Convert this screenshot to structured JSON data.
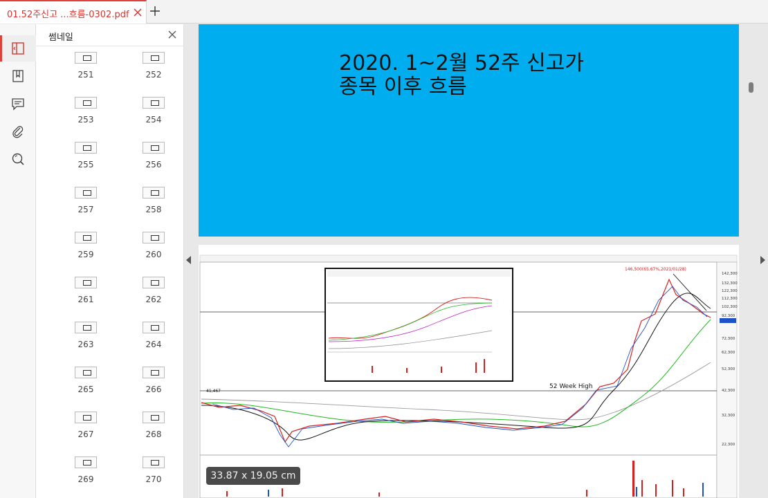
{
  "tabs": [
    {
      "title": "01.52주신고 ...흐름-0302.pdf"
    }
  ],
  "icons": {
    "tab_close": "close-icon",
    "new_tab": "plus-icon",
    "rail": [
      "sidebar-toggle-icon",
      "bookmark-icon",
      "comment-icon",
      "attachment-icon",
      "search-icon"
    ]
  },
  "colors": {
    "accent": "#e0403a",
    "slide_background": "#00adef"
  },
  "sidebar": {
    "title": "썸네일",
    "thumbnails": [
      "251",
      "252",
      "253",
      "254",
      "255",
      "256",
      "257",
      "258",
      "259",
      "260",
      "261",
      "262",
      "263",
      "264",
      "265",
      "266",
      "267",
      "268",
      "269",
      "270"
    ]
  },
  "document": {
    "slide_title": "2020. 1~2월 52주 신고가\n종목 이후 흐름",
    "chart_annotation": "52 Week High"
  },
  "status": {
    "page_size": "33.87 x 19.05 cm"
  }
}
